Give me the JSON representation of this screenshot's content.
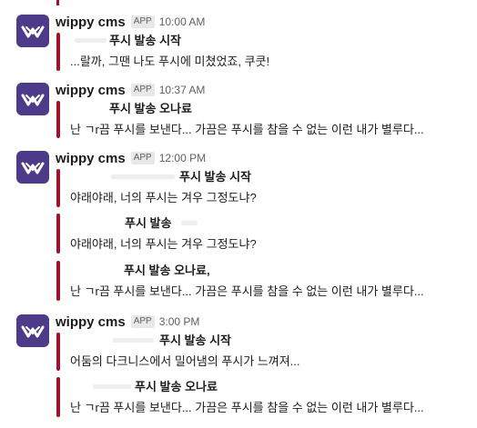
{
  "app": {
    "sender": "wippy cms",
    "badge": "APP"
  },
  "colors": {
    "accent_bar": "#a3122a",
    "avatar_bg": "#4d3a88"
  },
  "messages": [
    {
      "time": "10:00 AM",
      "attachments": [
        {
          "title": "푸시 발송 시작",
          "text": "...랄까, 그땐 나도 푸시에 미쳤었죠, 쿠쿳!"
        }
      ]
    },
    {
      "time": "10:37 AM",
      "attachments": [
        {
          "title": "푸시 발송 오나료",
          "text": "난 ㄱr끔 푸시를 보낸다... 가끔은 푸시를 참을 수 없는 이런 내가 별루다..."
        }
      ]
    },
    {
      "time": "12:00 PM",
      "attachments": [
        {
          "title": "푸시 발송 시작",
          "text": "야래야래, 너의 푸시는 겨우 그정도냐?"
        },
        {
          "title": "푸시 발송",
          "text": "야래야래, 너의 푸시는 겨우 그정도냐?"
        },
        {
          "title": "푸시 발송 오나료,",
          "text": "난 ㄱr끔 푸시를 보낸다... 가끔은 푸시를 참을 수 없는 이런 내가 별루다..."
        }
      ]
    },
    {
      "time": "3:00 PM",
      "attachments": [
        {
          "title": "푸시 발송 시작",
          "text": "어둠의 다크니스에서 밀어냄의 푸시가 느껴져..."
        },
        {
          "title": "푸시 발송 오나료",
          "text": "난 ㄱr끔 푸시를 보낸다... 가끔은 푸시를 참을 수 없는 이런 내가 별루다..."
        }
      ]
    }
  ]
}
